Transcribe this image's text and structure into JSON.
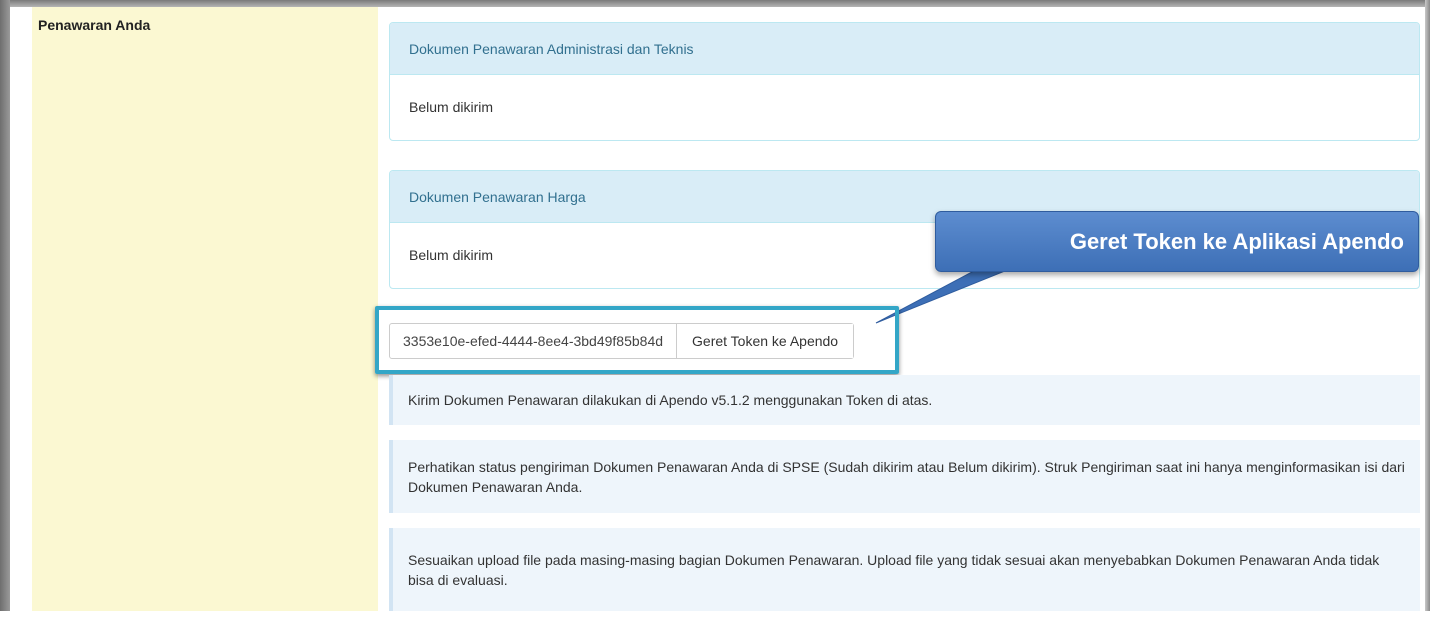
{
  "section_label": "Penawaran Anda",
  "panels": [
    {
      "heading": "Dokumen Penawaran Administrasi dan Teknis",
      "status": "Belum dikirim"
    },
    {
      "heading": "Dokumen Penawaran Harga",
      "status": "Belum dikirim"
    }
  ],
  "token": {
    "value": "3353e10e-efed-4444-8ee4-3bd49f85b84d",
    "button_label": "Geret Token ke Apendo"
  },
  "callout": {
    "text": "Geret Token ke Aplikasi Apendo"
  },
  "notes": [
    "Kirim Dokumen Penawaran dilakukan di Apendo v5.1.2 menggunakan Token di atas.",
    "Perhatikan status pengiriman Dokumen Penawaran Anda di SPSE (Sudah dikirim atau Belum dikirim). Struk Pengiriman saat ini hanya menginformasikan isi dari Dokumen Penawaran Anda.",
    "Sesuaikan upload file pada masing-masing bagian Dokumen Penawaran. Upload file yang tidak sesuai akan menyebabkan Dokumen Penawaran Anda tidak bisa di evaluasi."
  ],
  "colors": {
    "label_bg": "#fbf8d2",
    "panel_heading_bg": "#d9edf7",
    "panel_heading_text": "#31708f",
    "highlight_border": "#33a6c7",
    "callout_bg": "#4a7cc3",
    "note_bg": "#eef5fb"
  }
}
